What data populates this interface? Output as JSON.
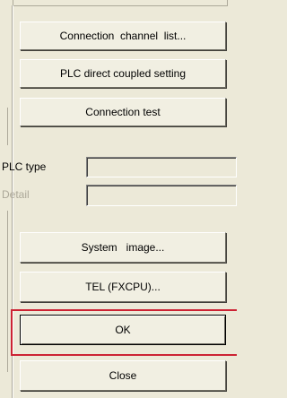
{
  "buttons": {
    "connection_channel_list": "Connection  channel  list...",
    "plc_direct_coupled": "PLC direct coupled setting",
    "connection_test": "Connection test",
    "system_image": "System   image...",
    "tel_fxcpu": "TEL (FXCPU)...",
    "ok": "OK",
    "close": "Close"
  },
  "fields": {
    "plc_type_label": "PLC type",
    "plc_type_value": "",
    "detail_label": "Detail",
    "detail_value": ""
  },
  "colors": {
    "highlight": "#cc2233",
    "disabled_text": "#aca899",
    "face": "#ece9d8"
  }
}
